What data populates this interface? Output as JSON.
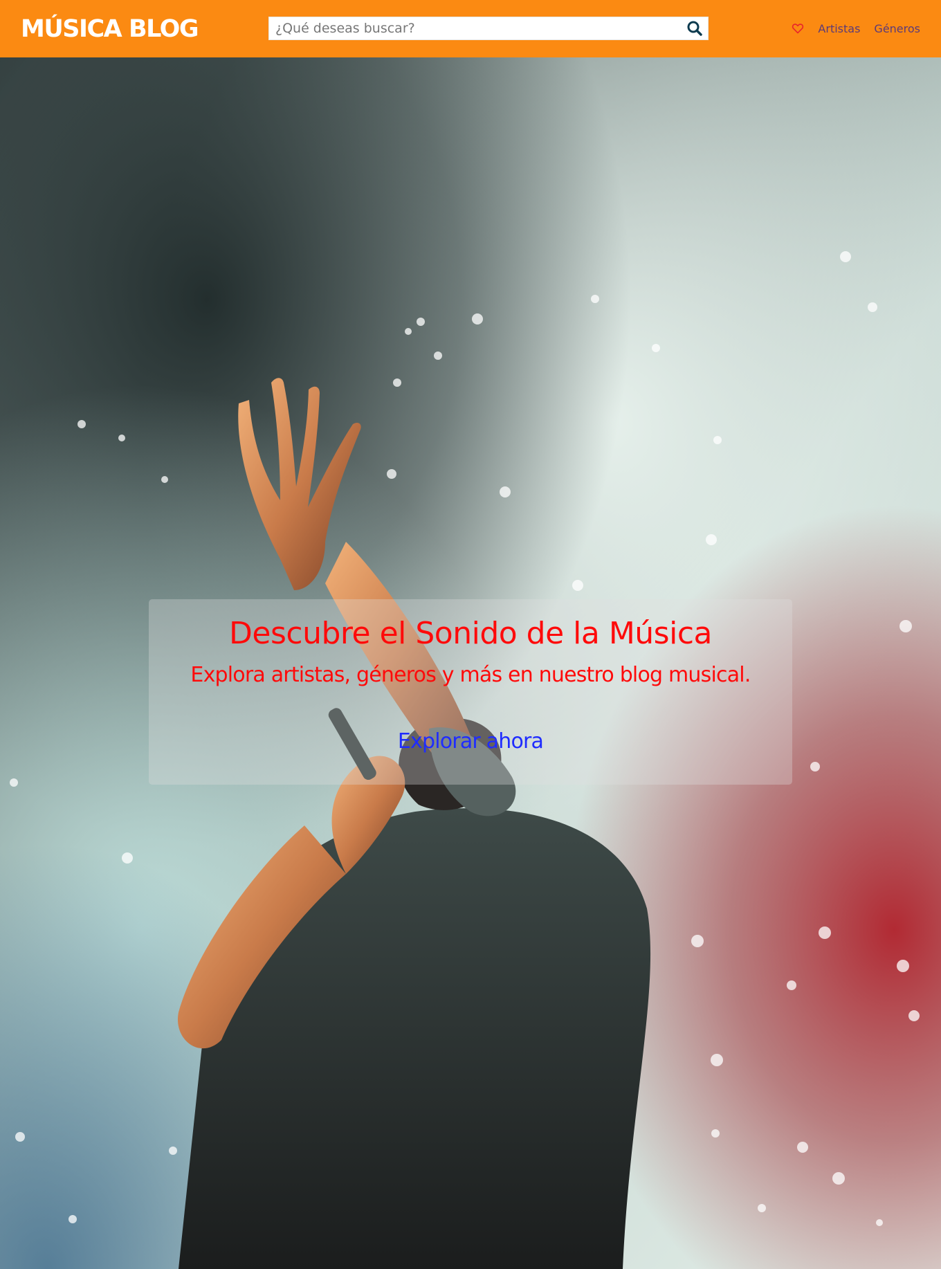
{
  "brand": {
    "name": "MÚSICA BLOG"
  },
  "search": {
    "placeholder": "¿Qué deseas buscar?",
    "icon": "search-icon"
  },
  "nav": {
    "favorites_icon": "heart-icon",
    "links": [
      "Artistas",
      "Géneros"
    ]
  },
  "hero": {
    "title": "Descubre el Sonido de la Música",
    "subtitle": "Explora artistas, géneros y más en nuestro blog musical.",
    "cta": "Explorar ahora",
    "background_image": "concert-singer-photo"
  },
  "colors": {
    "navbar": "#fb8a12",
    "brand_text": "#ffffff",
    "nav_link": "#5b3a78",
    "heart": "#e8242b",
    "hero_text": "#ff0a0a",
    "cta_text": "#1f2cff"
  }
}
